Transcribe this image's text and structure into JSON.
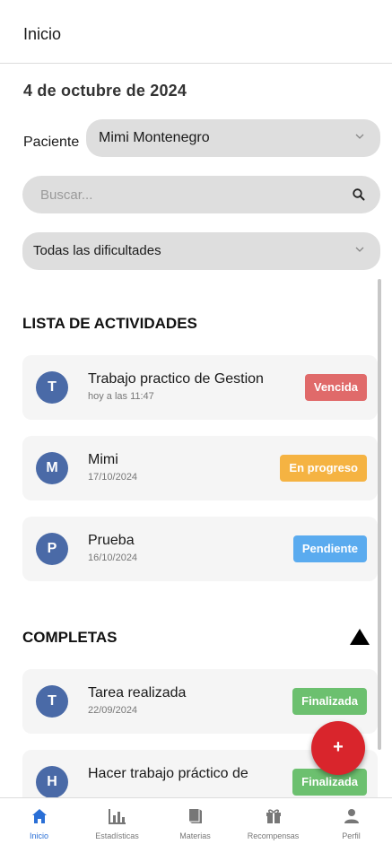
{
  "header": {
    "title": "Inicio"
  },
  "date": "4 de octubre de 2024",
  "patient": {
    "label": "Paciente",
    "selected": "Mimi Montenegro"
  },
  "search": {
    "placeholder": "Buscar..."
  },
  "difficulty": {
    "selected": "Todas las dificultades"
  },
  "activities": {
    "title": "LISTA DE ACTIVIDADES",
    "items": [
      {
        "initial": "T",
        "title": "Trabajo practico de Gestion",
        "subtitle": "hoy a las 11:47",
        "status": "Vencida",
        "status_color": "#e06a6a"
      },
      {
        "initial": "M",
        "title": "Mimi",
        "subtitle": "17/10/2024",
        "status": "En progreso",
        "status_color": "#f5b342"
      },
      {
        "initial": "P",
        "title": "Prueba",
        "subtitle": "16/10/2024",
        "status": "Pendiente",
        "status_color": "#5aabef"
      }
    ]
  },
  "completed": {
    "title": "COMPLETAS",
    "items": [
      {
        "initial": "T",
        "title": "Tarea realizada",
        "subtitle": "22/09/2024",
        "status": "Finalizada",
        "status_color": "#6cc06f"
      },
      {
        "initial": "H",
        "title": "Hacer trabajo práctico de",
        "subtitle": "",
        "status": "Finalizada",
        "status_color": "#6cc06f"
      }
    ]
  },
  "fab": {
    "label": "+"
  },
  "nav": {
    "items": [
      {
        "label": "Inicio",
        "icon": "home-icon",
        "active": true
      },
      {
        "label": "Estadísticas",
        "icon": "stats-icon",
        "active": false
      },
      {
        "label": "Materias",
        "icon": "book-icon",
        "active": false
      },
      {
        "label": "Recompensas",
        "icon": "gift-icon",
        "active": false
      },
      {
        "label": "Perfil",
        "icon": "user-icon",
        "active": false
      }
    ]
  },
  "colors": {
    "accent": "#2a6fd6",
    "avatar": "#4a6aa7",
    "fab": "#d9252c",
    "field": "#dedede"
  }
}
